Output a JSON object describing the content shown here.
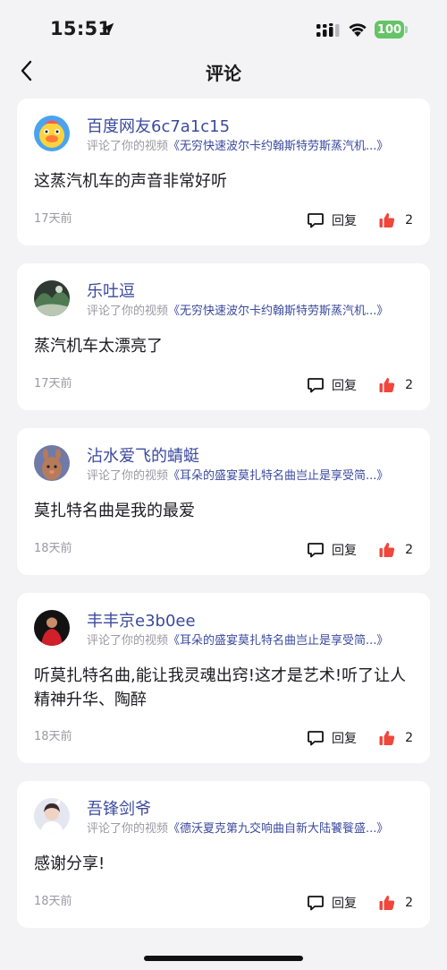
{
  "status_bar": {
    "time": "15:51",
    "battery": "100"
  },
  "nav": {
    "title": "评论"
  },
  "comments": [
    {
      "username": "百度网友6c7a1c15",
      "action": "评论了你的视频",
      "video": "《无穷快速波尔卡约翰斯特劳斯蒸汽机...》",
      "text": "这蒸汽机车的声音非常好听",
      "time": "17天前",
      "reply_label": "回复",
      "likes": "2"
    },
    {
      "username": "乐吐逗",
      "action": "评论了你的视频",
      "video": "《无穷快速波尔卡约翰斯特劳斯蒸汽机...》",
      "text": "蒸汽机车太漂亮了",
      "time": "17天前",
      "reply_label": "回复",
      "likes": "2"
    },
    {
      "username": "沾水爱飞的蜻蜓",
      "action": "评论了你的视频",
      "video": "《耳朵的盛宴莫扎特名曲岂止是享受简...》",
      "text": "莫扎特名曲是我的最爱",
      "time": "18天前",
      "reply_label": "回复",
      "likes": "2"
    },
    {
      "username": "丰丰京e3b0ee",
      "action": "评论了你的视频",
      "video": "《耳朵的盛宴莫扎特名曲岂止是享受简...》",
      "text": "听莫扎特名曲,能让我灵魂出窍!这才是艺术!听了让人精神升华、陶醉",
      "time": "18天前",
      "reply_label": "回复",
      "likes": "2"
    },
    {
      "username": "吾锋剑爷",
      "action": "评论了你的视频",
      "video": "《德沃夏克第九交响曲自新大陆饕餮盛...》",
      "text": "感谢分享!",
      "time": "18天前",
      "reply_label": "回复",
      "likes": "2"
    }
  ],
  "colors": {
    "accent": "#3b4a9e",
    "like": "#f0463c",
    "battery": "#65c466"
  }
}
